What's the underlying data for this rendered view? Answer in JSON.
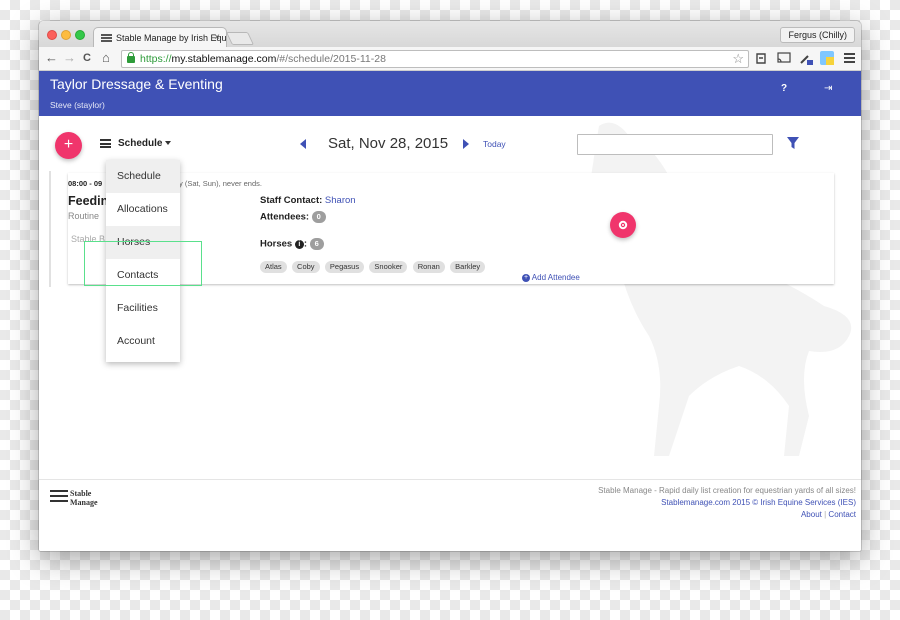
{
  "browser": {
    "tab_title": "Stable Manage by Irish Equ",
    "tab_close": "×",
    "profile_name": "Fergus (Chilly)",
    "url_scheme": "https://",
    "url_host": "my.stablemanage.com",
    "url_path": "/#/schedule/2015-11-28",
    "back_icon": "←",
    "forward_icon": "→",
    "reload_icon": "C",
    "home_icon": "⌂",
    "star_icon": "☆",
    "menu_icon": "≡"
  },
  "app": {
    "title": "Taylor Dressage & Eventing",
    "user": "Steve (staylor)",
    "help_label": "?",
    "logout_label": "⇥",
    "accent": "#3f51b5",
    "fab_color": "#f0356c"
  },
  "toolbar": {
    "fab_label": "+",
    "nav_label": "Schedule",
    "date": "Sat, Nov 28, 2015",
    "today_label": "Today",
    "search_placeholder": ""
  },
  "menu": {
    "items": [
      {
        "label": "Schedule",
        "active": true
      },
      {
        "label": "Allocations",
        "active": false
      },
      {
        "label": "Horses",
        "active": true
      },
      {
        "label": "Contacts",
        "active": false
      },
      {
        "label": "Facilities",
        "active": false
      },
      {
        "label": "Account",
        "active": false
      }
    ]
  },
  "event": {
    "time": "08:00 - 09",
    "recurrence": "y (Sat, Sun), never ends.",
    "title": "Feedin",
    "type": "Routine",
    "location": "Stable B",
    "staff_label": "Staff Contact:",
    "staff_name": "Sharon",
    "attendees_label": "Attendees:",
    "attendees_count": "0",
    "horses_label": "Horses",
    "horses_count": "6",
    "horses": [
      "Atlas",
      "Coby",
      "Pegasus",
      "Snooker",
      "Ronan",
      "Barkley"
    ],
    "add_attendee_label": "Add Attendee"
  },
  "footer": {
    "logo_line1": "Stable",
    "logo_line2": "Manage",
    "tagline": "Stable Manage - Rapid daily list creation for equestrian yards of all sizes!",
    "copyright": "Stablemanage.com 2015 © Irish Equine Services (IES)",
    "about_label": "About",
    "separator": "|",
    "contact_label": "Contact"
  }
}
